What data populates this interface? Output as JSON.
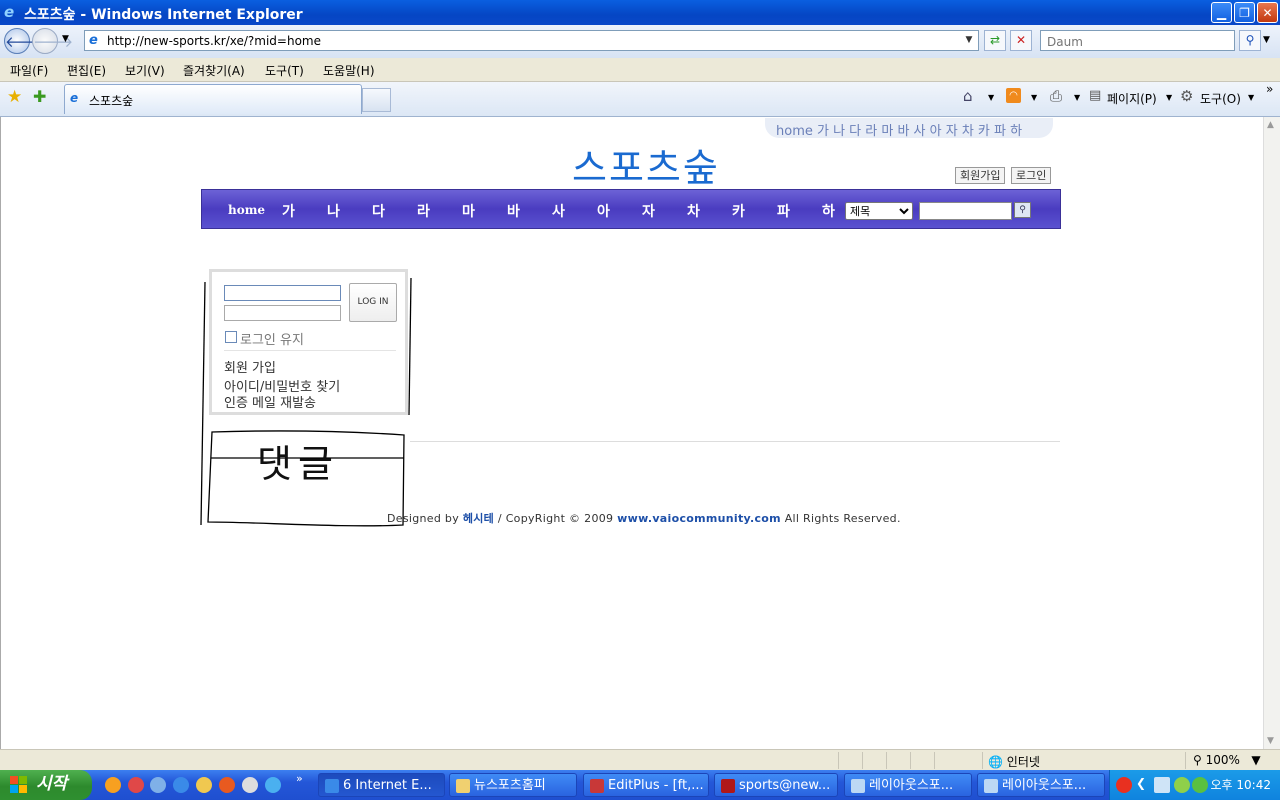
{
  "window": {
    "title": "스포츠숲 - Windows Internet Explorer"
  },
  "address": {
    "url": "http://new-sports.kr/xe/?mid=home",
    "search_placeholder": "Daum"
  },
  "menu": [
    "파일(F)",
    "편집(E)",
    "보기(V)",
    "즐겨찾기(A)",
    "도구(T)",
    "도움말(H)"
  ],
  "tab": {
    "label": "스포츠숲"
  },
  "toolbar": {
    "page": "페이지(P)",
    "tools": "도구(O)"
  },
  "site": {
    "toplinks": "home 가 나 다 라 마 바 사 아 자 차 카 파 하",
    "logo": "스포츠숲",
    "join": "회원가입",
    "login": "로그인",
    "gnb": [
      "home",
      "가",
      "나",
      "다",
      "라",
      "마",
      "바",
      "사",
      "아",
      "자",
      "차",
      "카",
      "파",
      "하"
    ],
    "search_option": "제목"
  },
  "loginbox": {
    "button": "LOG IN",
    "keep": "로그인 유지",
    "links": [
      "회원 가입",
      "아이디/비밀번호 찾기",
      "인증 메일 재발송"
    ]
  },
  "annotation": "댓글",
  "footer": {
    "designed": "Designed by",
    "designer": "헤시테",
    "copy": "/ CopyRight © 2009",
    "site": "www.vaiocommunity.com",
    "rights": "All Rights Reserved."
  },
  "status": {
    "zone": "인터넷",
    "zoom": "100%"
  },
  "taskbar": {
    "start": "시작",
    "tasks": [
      "6 Internet E...",
      "뉴스포츠홈피",
      "EditPlus - [ft,...",
      "sports@new...",
      "레이아웃스포...",
      "레이아웃스포..."
    ],
    "clock": "오후 10:42"
  }
}
